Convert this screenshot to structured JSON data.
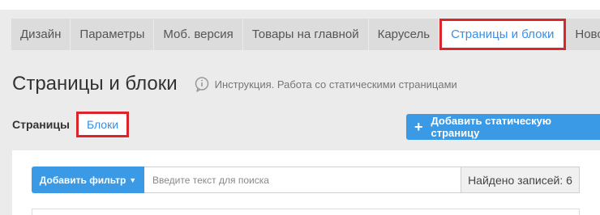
{
  "tabs": [
    {
      "label": "Дизайн",
      "active": false
    },
    {
      "label": "Параметры",
      "active": false
    },
    {
      "label": "Моб. версия",
      "active": false
    },
    {
      "label": "Товары на главной",
      "active": false
    },
    {
      "label": "Карусель",
      "active": false
    },
    {
      "label": "Страницы и блоки",
      "active": true
    },
    {
      "label": "Новости",
      "active": false
    }
  ],
  "header": {
    "title": "Страницы и блоки",
    "help_icon": "info-bubble-icon",
    "help_text": "Инструкция. Работа со статическими страницами"
  },
  "subnav": {
    "label": "Страницы",
    "link": "Блоки"
  },
  "actions": {
    "add_page_label": "Добавить статическую страницу",
    "add_page_icon": "plus-icon"
  },
  "filter": {
    "add_filter_label": "Добавить фильтр",
    "search_placeholder": "Введите текст для поиска",
    "found_text": "Найдено записей: 6"
  },
  "colors": {
    "accent": "#3b9ae5",
    "highlight": "#d9262b"
  }
}
